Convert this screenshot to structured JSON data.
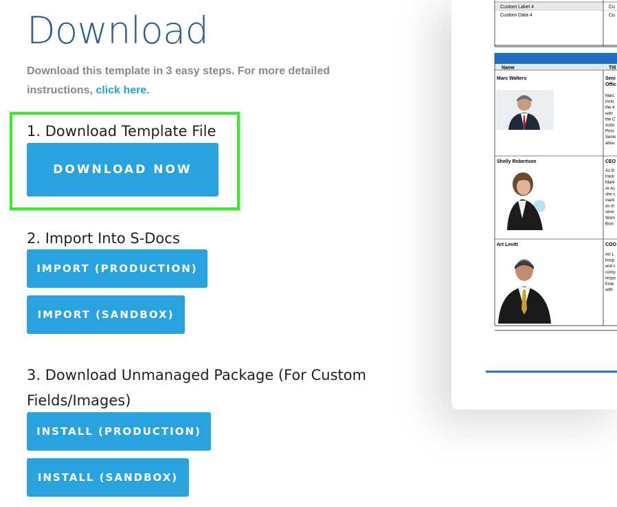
{
  "page": {
    "title": "Download",
    "intro_text": "Download this template in 3 easy steps. For more detailed instructions, ",
    "intro_link": "click here",
    "intro_end": "."
  },
  "steps": {
    "step1": {
      "label": "1. Download Template File",
      "button": "DOWNLOAD NOW"
    },
    "step2": {
      "label": "2. Import Into S-Docs",
      "button_prod": "IMPORT (PRODUCTION)",
      "button_sandbox": "IMPORT (SANDBOX)"
    },
    "step3": {
      "label_line1": "3. Download Unmanaged Package (For Custom",
      "label_line2": "Fields/Images)",
      "button_prod": "INSTALL (PRODUCTION)",
      "button_sandbox": "INSTALL (SANDBOX)"
    }
  },
  "preview": {
    "top_rows": [
      {
        "left": "Custom Label 4",
        "right": "Cu"
      },
      {
        "left": "Custom Data 4",
        "right": "Cu"
      }
    ],
    "table_headers": {
      "name": "Name",
      "title": "Titl"
    },
    "people": [
      {
        "name": "Marc Walters",
        "title_lines": [
          "Seni",
          "Offic"
        ],
        "bio_lines": [
          "Marc",
          "inclu",
          "the 4",
          "with",
          "the C",
          "Actio",
          "Prior",
          "Senio",
          "abou"
        ]
      },
      {
        "name": "Shelly Robertson",
        "title_lines": [
          "CEO"
        ],
        "bio_lines": [
          "As th",
          "track",
          "Mark",
          "At Ac",
          "she s",
          "mark",
          "as or",
          "seve",
          "Wom",
          "Busi"
        ]
      },
      {
        "name": "Art Levitt",
        "title_lines": [
          "COO"
        ],
        "bio_lines": [
          "Art L",
          "hosp",
          "and c",
          "comp",
          "respo",
          "Ente",
          "with"
        ]
      }
    ]
  },
  "colors": {
    "title": "#2c5f8c",
    "button": "#29a3e0",
    "highlight": "#33ee22",
    "link": "#2a9fd8",
    "doc_header_bar": "#1f6fc2"
  }
}
